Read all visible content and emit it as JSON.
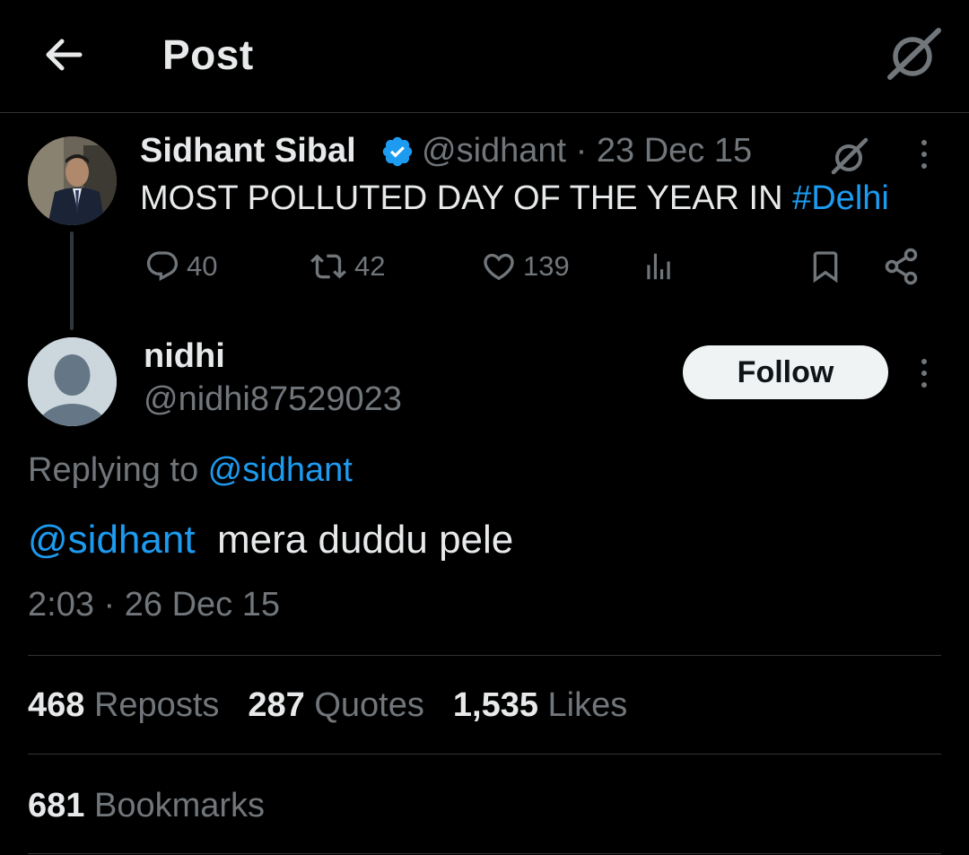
{
  "header": {
    "title": "Post"
  },
  "parent_tweet": {
    "author_name": "Sidhant Sibal",
    "verified": true,
    "handle": "@sidhant",
    "separator": " · ",
    "date": "23 Dec 15",
    "text_prefix": "MOST POLLUTED DAY OF THE YEAR IN ",
    "hashtag": "#Delhi",
    "actions": {
      "replies": "40",
      "reposts": "42",
      "likes": "139"
    }
  },
  "reply": {
    "author_name": "nidhi",
    "handle": "@nidhi87529023",
    "follow_label": "Follow",
    "replying_label": "Replying to ",
    "replying_to": "@sidhant",
    "mention": "@sidhant",
    "text": "mera duddu pele",
    "time": "2:03",
    "date_separator": " · ",
    "date": "26 Dec 15"
  },
  "stats": {
    "reposts_count": "468",
    "reposts_label": "Reposts",
    "quotes_count": "287",
    "quotes_label": "Quotes",
    "likes_count": "1,535",
    "likes_label": "Likes",
    "bookmarks_count": "681",
    "bookmarks_label": "Bookmarks"
  },
  "colors": {
    "background": "#000000",
    "text_primary": "#e7e9ea",
    "text_secondary": "#71767b",
    "accent": "#1d9bf0",
    "divider": "#2f3336",
    "follow_button_bg": "#eff3f4"
  },
  "icons": {
    "back": "arrow-left-icon",
    "grok": "grok-icon",
    "verified": "verified-badge-icon",
    "more": "more-vertical-icon",
    "reply": "reply-icon",
    "repost": "repost-icon",
    "like": "heart-icon",
    "views": "views-icon",
    "bookmark": "bookmark-icon",
    "share": "share-icon"
  }
}
